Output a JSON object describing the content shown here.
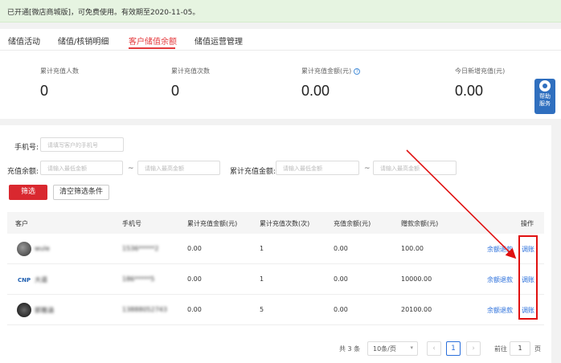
{
  "banner": {
    "text": "已开通[微店商城版]，可免费使用。有效期至2020-11-05。"
  },
  "tabs": [
    {
      "label": "储值活动"
    },
    {
      "label": "储值/核销明细"
    },
    {
      "label": "客户储值余额"
    },
    {
      "label": "储值运营管理"
    }
  ],
  "stats": [
    {
      "label": "累计充值人数",
      "value": "0"
    },
    {
      "label": "累计充值次数",
      "value": "0"
    },
    {
      "label": "累计充值金额(元)",
      "value": "0.00"
    },
    {
      "label": "今日新增充值(元)",
      "value": "0.00"
    }
  ],
  "float_help": {
    "line1": "帮助",
    "line2": "服务"
  },
  "filters": {
    "phone_label": "手机号:",
    "phone_placeholder": "请填写客户的手机号",
    "balance_label": "充值余额:",
    "total_label": "累计充值金额:",
    "min_placeholder": "请输入最低金额",
    "max_placeholder": "请输入最高金额",
    "tilde": "~",
    "filter_button": "筛选",
    "clear_button": "清空筛选条件"
  },
  "table": {
    "headers": [
      "客户",
      "手机号",
      "累计充值金额(元)",
      "累计充值次数(次)",
      "充值余额(元)",
      "赠款余额(元)",
      "操作"
    ],
    "rows": [
      {
        "name": "wule",
        "phone": "1536*****2",
        "total": "0.00",
        "count": "1",
        "balance": "0.00",
        "gift": "100.00",
        "refund": "余额退款",
        "adjust": "调账"
      },
      {
        "name": "大道",
        "phone": "186*****5",
        "total": "0.00",
        "count": "1",
        "balance": "0.00",
        "gift": "10000.00",
        "refund": "余额退款",
        "adjust": "调账"
      },
      {
        "name": "郭雅涵",
        "phone": "13888052743",
        "total": "0.00",
        "count": "5",
        "balance": "0.00",
        "gift": "20100.00",
        "refund": "余额退款",
        "adjust": "调账"
      }
    ]
  },
  "pager": {
    "total_text": "共 3 条",
    "page_size": "10条/页",
    "prev": "‹",
    "current": "1",
    "next": "›",
    "goto_prefix": "前往",
    "goto_value": "1",
    "goto_suffix": "页"
  },
  "annotation_color": "#e01010",
  "accent_color": "#e4393c",
  "link_color": "#2a6fdb"
}
